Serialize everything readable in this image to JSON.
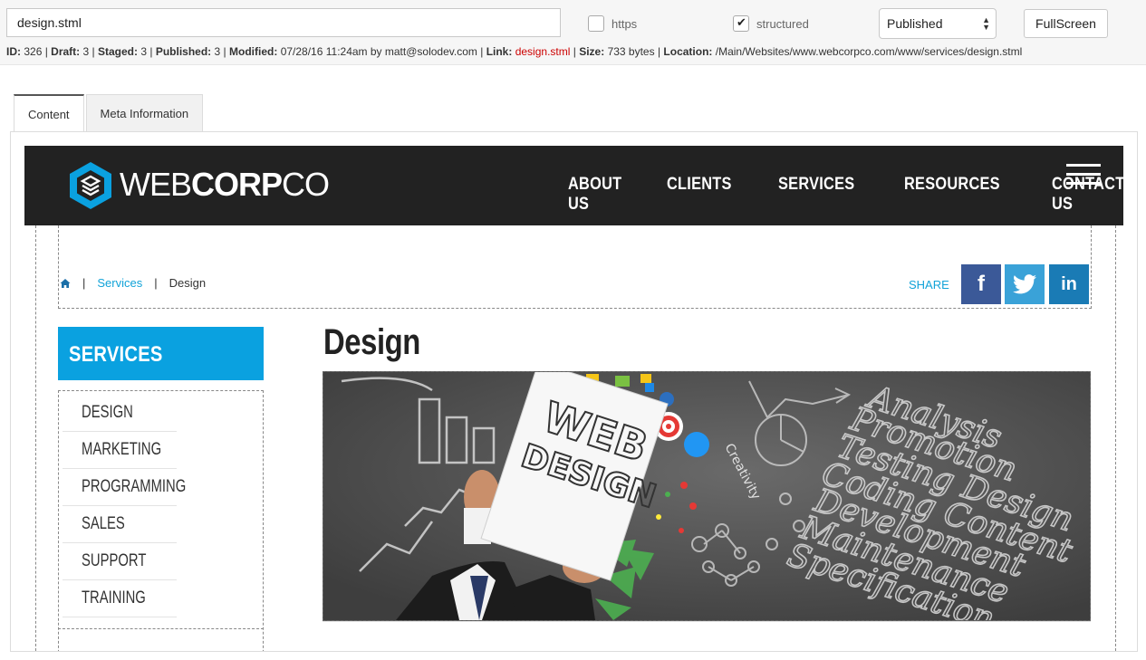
{
  "toolbar": {
    "filename": "design.stml",
    "https_label": "https",
    "https_checked": false,
    "structured_label": "structured",
    "structured_checked": true,
    "status_value": "Published",
    "fullscreen_label": "FullScreen"
  },
  "meta": {
    "id_label": "ID:",
    "id": "326",
    "draft_label": "Draft:",
    "draft": "3",
    "staged_label": "Staged:",
    "staged": "3",
    "published_label": "Published:",
    "published": "3",
    "modified_label": "Modified:",
    "modified": "07/28/16 11:24am by matt@solodev.com",
    "link_label": "Link:",
    "link": "design.stml",
    "size_label": "Size:",
    "size": "733 bytes",
    "location_label": "Location:",
    "location": "/Main/Websites/www.webcorpco.com/www/services/design.stml"
  },
  "tabs": [
    {
      "label": "Content",
      "active": true
    },
    {
      "label": "Meta Information",
      "active": false
    }
  ],
  "site": {
    "logo_thin": "WEB",
    "logo_bold": "CORP",
    "logo_tail": "CO",
    "nav": [
      "ABOUT US",
      "CLIENTS",
      "SERVICES",
      "RESOURCES",
      "CONTACT US"
    ],
    "menu_icon": "hamburger-icon",
    "breadcrumb": {
      "home_icon": "home-icon",
      "link": "Services",
      "current": "Design"
    },
    "share_label": "SHARE",
    "social": [
      {
        "name": "facebook",
        "glyph": "f",
        "color": "#3b5998"
      },
      {
        "name": "twitter",
        "glyph": "twitter-bird-icon",
        "color": "#3aa2d8"
      },
      {
        "name": "linkedin",
        "glyph": "in",
        "color": "#1a7bb5"
      }
    ],
    "sidebar_heading": "SERVICES",
    "sidebar_items": [
      "DESIGN",
      "MARKETING",
      "PROGRAMMING",
      "SALES",
      "SUPPORT",
      "TRAINING"
    ],
    "page_title": "Design",
    "hero": {
      "sign_text_line1": "WEB",
      "sign_text_line2": "DESIGN",
      "chalk_words": [
        "Analysis",
        "Promotion",
        "Testing Design",
        "Coding Content",
        "Development",
        "Maintenance",
        "Specification"
      ],
      "chalk_curve_word": "Creativity"
    }
  },
  "colors": {
    "accent_blue": "#0aa1e0",
    "link_blue": "#12a3d8",
    "header_dark": "#222222",
    "meta_link_red": "#cc0000"
  }
}
